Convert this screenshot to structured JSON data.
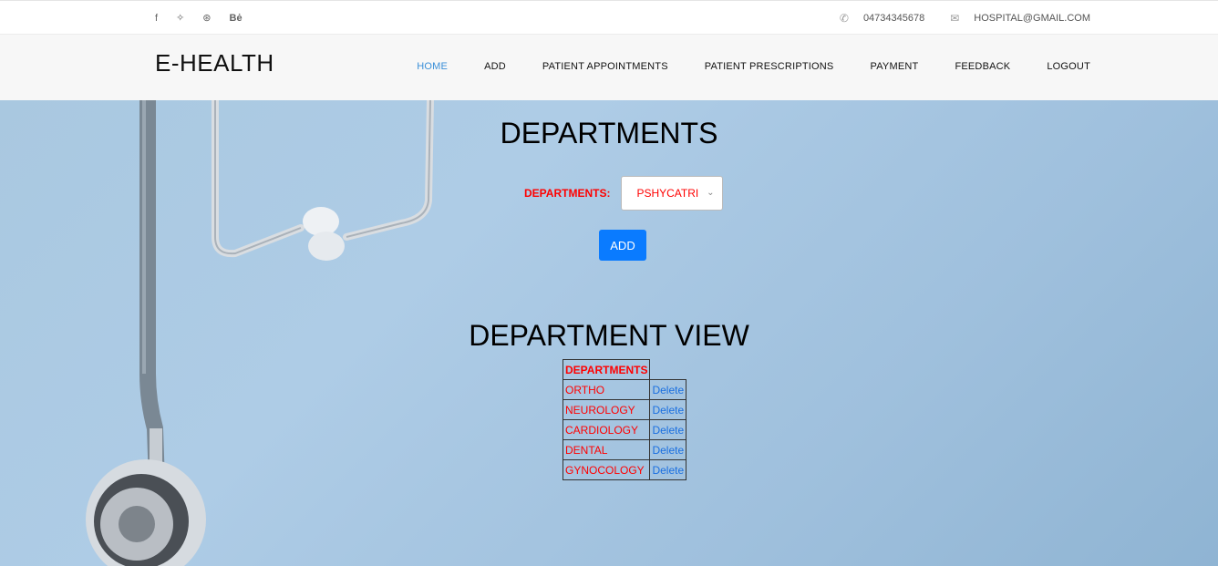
{
  "topbar": {
    "social": [
      {
        "icon": "facebook-icon",
        "glyph": "f"
      },
      {
        "icon": "twitter-icon",
        "glyph": "✧"
      },
      {
        "icon": "dribbble-icon",
        "glyph": "⊛"
      },
      {
        "icon": "behance-icon",
        "glyph": "Bė"
      }
    ],
    "phone": "04734345678",
    "email": "HOSPITAL@GMAIL.COM"
  },
  "header": {
    "logo": "E-HEALTH",
    "nav": [
      "HOME",
      "ADD",
      "PATIENT APPOINTMENTS",
      "PATIENT PRESCRIPTIONS",
      "PAYMENT",
      "FEEDBACK",
      "LOGOUT"
    ],
    "active": "HOME"
  },
  "form": {
    "title": "DEPARTMENTS",
    "label": "DEPARTMENTS:",
    "selected": "PSHYCATRI",
    "add_label": "ADD"
  },
  "view": {
    "title": "DEPARTMENT VIEW",
    "header": "DEPARTMENTS",
    "delete_label": "Delete",
    "rows": [
      "ORTHO",
      "NEUROLOGY",
      "CARDIOLOGY",
      "DENTAL",
      "GYNOCOLOGY"
    ]
  },
  "colors": {
    "accent": "#0a7bff",
    "nav_active": "#3a8fd8",
    "label_red": "#ff0000"
  }
}
